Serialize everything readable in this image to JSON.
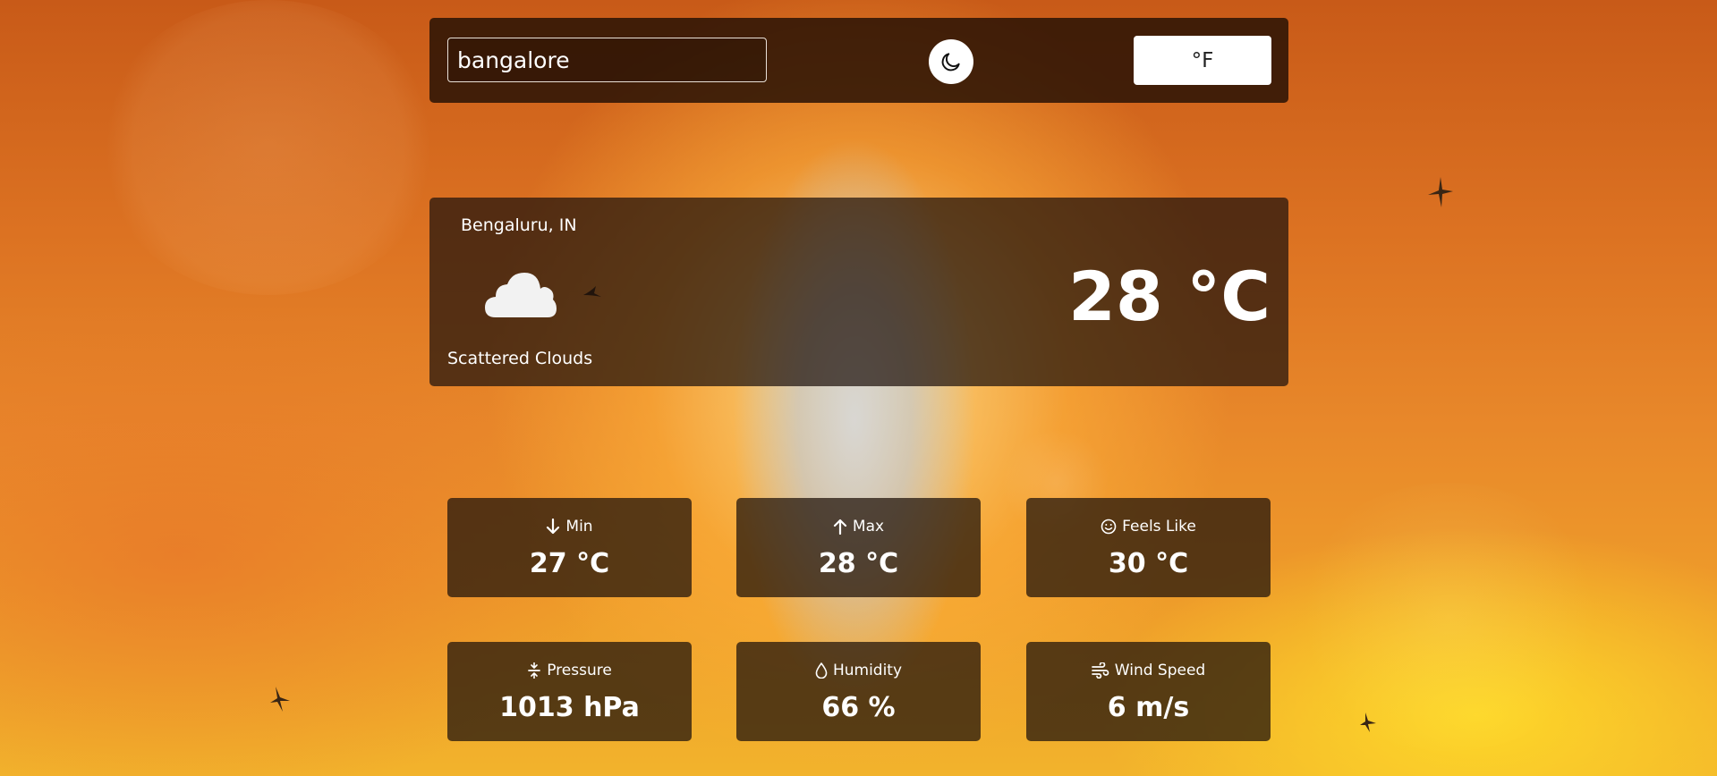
{
  "search": {
    "value": "bangalore",
    "placeholder": ""
  },
  "theme_toggle": {
    "icon": "moon-icon"
  },
  "unit_toggle": {
    "label": "°F"
  },
  "current": {
    "location": "Bengaluru, IN",
    "condition_icon": "cloud-icon",
    "description": "Scattered Clouds",
    "temperature": "28 °C"
  },
  "stats": [
    {
      "label": "Min",
      "icon": "arrow-down-icon",
      "value": "27 °C"
    },
    {
      "label": "Max",
      "icon": "arrow-up-icon",
      "value": "28 °C"
    },
    {
      "label": "Feels Like",
      "icon": "smiley-icon",
      "value": "30 °C"
    },
    {
      "label": "Pressure",
      "icon": "pressure-icon",
      "value": "1013 hPa"
    },
    {
      "label": "Humidity",
      "icon": "droplet-icon",
      "value": "66 %"
    },
    {
      "label": "Wind Speed",
      "icon": "wind-icon",
      "value": "6 m/s"
    }
  ],
  "colors": {
    "panel_bg": "#1c120a",
    "text": "#ffffff",
    "button_bg": "#ffffff"
  }
}
